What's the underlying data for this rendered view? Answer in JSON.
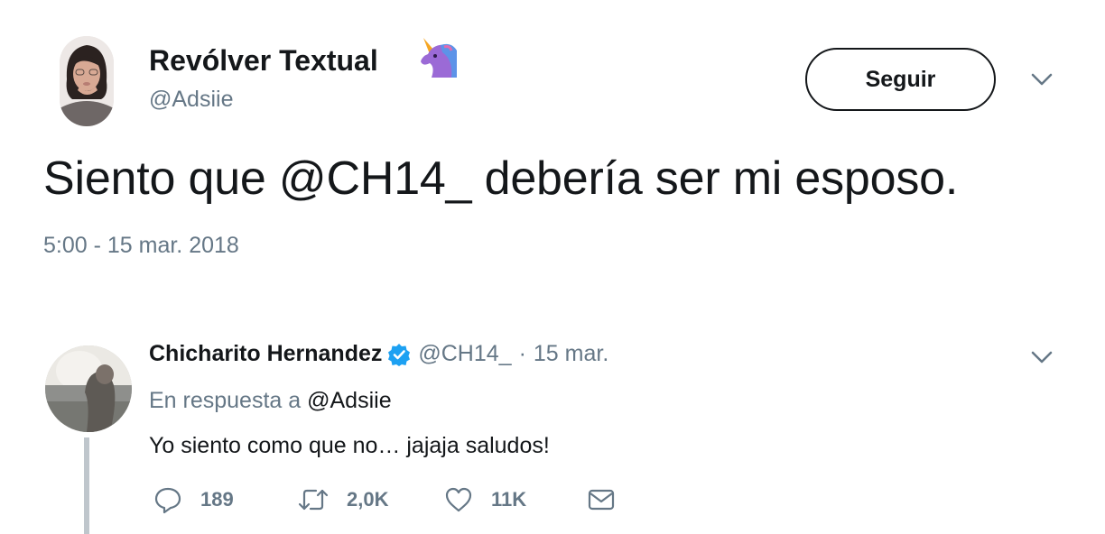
{
  "tweet": {
    "display_name": "Revólver Textual",
    "name_emoji": "unicorn-icon",
    "handle": "@Adsiie",
    "follow_label": "Seguir",
    "text": "Siento que @CH14_ debería ser mi esposo.",
    "timestamp": "5:00 - 15 mar. 2018"
  },
  "reply": {
    "display_name": "Chicharito Hernandez",
    "verified": true,
    "handle": "@CH14_",
    "separator": "·",
    "date": "15 mar.",
    "in_reply_prefix": "En respuesta a",
    "in_reply_handle": "@Adsiie",
    "text": "Yo siento como que no… jajaja saludos!",
    "actions": {
      "replies": "189",
      "retweets": "2,0K",
      "likes": "11K"
    }
  },
  "colors": {
    "text_primary": "#14171a",
    "text_secondary": "#657786",
    "verified_blue": "#1da1f2",
    "thread_line": "#bfc6cc"
  }
}
